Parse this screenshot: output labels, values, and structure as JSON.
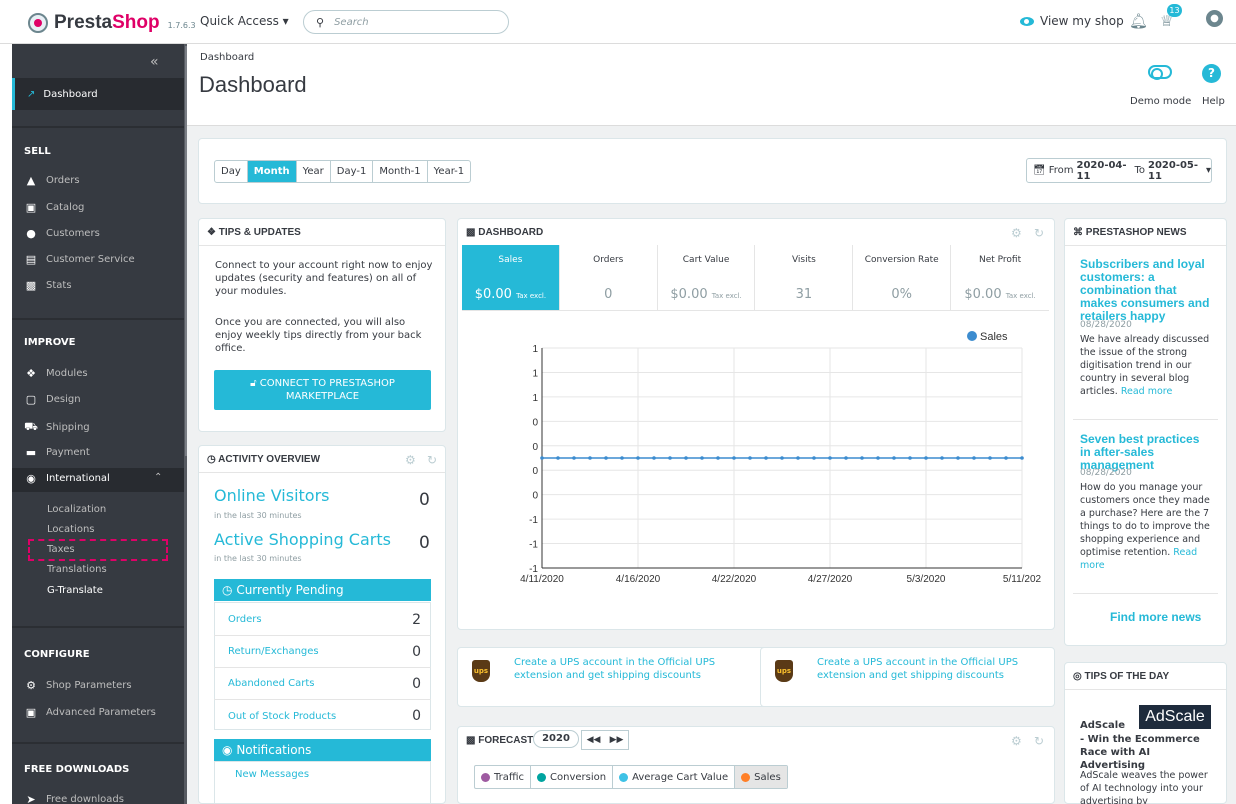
{
  "app": {
    "brand_a": "Presta",
    "brand_b": "Shop",
    "version": "1.7.6.3",
    "quick_access": "Quick Access ▾",
    "search_placeholder": "Search",
    "view_shop": "View my shop",
    "notif_count": "13"
  },
  "sidebar": {
    "dashboard": "Dashboard",
    "sell": "SELL",
    "orders": "Orders",
    "catalog": "Catalog",
    "customers": "Customers",
    "customer_service": "Customer Service",
    "stats": "Stats",
    "improve": "IMPROVE",
    "modules": "Modules",
    "design": "Design",
    "shipping": "Shipping",
    "payment": "Payment",
    "international": "International",
    "sub": [
      "Localization",
      "Locations",
      "Taxes",
      "Translations",
      "G-Translate"
    ],
    "configure": "CONFIGURE",
    "shop_params": "Shop Parameters",
    "adv_params": "Advanced Parameters",
    "free": "FREE DOWNLOADS",
    "free_dl": "Free downloads"
  },
  "header": {
    "breadcrumb": "Dashboard",
    "title": "Dashboard",
    "demo": "Demo mode",
    "help": "Help"
  },
  "period": {
    "buttons": [
      "Day",
      "Month",
      "Year",
      "Day-1",
      "Month-1",
      "Year-1"
    ],
    "active": 1,
    "from_label": "From",
    "from": "2020-04-11",
    "to_label": "To",
    "to": "2020-05-11"
  },
  "tips": {
    "title": "TIPS & UPDATES",
    "p1": "Connect to your account right now to enjoy updates (security and features) on all of your modules.",
    "p2": "Once you are connected, you will also enjoy weekly tips directly from your back office.",
    "button": "CONNECT TO PRESTASHOP MARKETPLACE"
  },
  "activity": {
    "title": "ACTIVITY OVERVIEW",
    "visitors": "Online Visitors",
    "visitors_sub": "in the last 30 minutes",
    "visitors_n": "0",
    "carts": "Active Shopping Carts",
    "carts_sub": "in the last 30 minutes",
    "carts_n": "0",
    "pending": "Currently Pending",
    "rows": [
      {
        "label": "Orders",
        "n": "2"
      },
      {
        "label": "Return/Exchanges",
        "n": "0"
      },
      {
        "label": "Abandoned Carts",
        "n": "0"
      },
      {
        "label": "Out of Stock Products",
        "n": "0"
      }
    ],
    "notifications": "Notifications",
    "new_messages": "New Messages"
  },
  "dashboard": {
    "title": "DASHBOARD",
    "kpis": [
      {
        "t": "Sales",
        "v": "$0.00",
        "s": "Tax excl."
      },
      {
        "t": "Orders",
        "v": "0",
        "s": ""
      },
      {
        "t": "Cart Value",
        "v": "$0.00",
        "s": "Tax excl."
      },
      {
        "t": "Visits",
        "v": "31",
        "s": ""
      },
      {
        "t": "Conversion Rate",
        "v": "0%",
        "s": ""
      },
      {
        "t": "Net Profit",
        "v": "$0.00",
        "s": "Tax excl."
      }
    ]
  },
  "chart_data": {
    "type": "line",
    "series": [
      {
        "name": "Sales",
        "values": [
          0,
          0,
          0,
          0,
          0,
          0,
          0,
          0,
          0,
          0,
          0,
          0,
          0,
          0,
          0,
          0,
          0,
          0,
          0,
          0,
          0,
          0,
          0,
          0,
          0,
          0,
          0,
          0,
          0,
          0,
          0
        ]
      }
    ],
    "x_ticks": [
      "4/11/2020",
      "4/16/2020",
      "4/22/2020",
      "4/27/2020",
      "5/3/2020",
      "5/11/202"
    ],
    "y_ticks": [
      "1",
      "1",
      "1",
      "0",
      "0",
      "0",
      "0",
      "-1",
      "-1",
      "-1"
    ],
    "ylim": [
      -1,
      1
    ],
    "color": "#3c8ccf",
    "legend": "top-right",
    "grid": true
  },
  "ups": [
    {
      "text": "Create a UPS account in the Official UPS extension and get shipping discounts"
    },
    {
      "text": "Create a UPS account in the Official UPS extension and get shipping discounts"
    }
  ],
  "ups_logo": "ups",
  "forecast": {
    "title": "FORECAST",
    "year": "2020",
    "legend": [
      {
        "name": "Traffic",
        "color": "#9e5ba1"
      },
      {
        "name": "Conversion",
        "color": "#00a4a0"
      },
      {
        "name": "Average Cart Value",
        "color": "#3ec2e6"
      },
      {
        "name": "Sales",
        "color": "#ff7f27"
      }
    ]
  },
  "news": {
    "title": "PRESTASHOP NEWS",
    "items": [
      {
        "title": "Subscribers and loyal customers: a combination that makes consumers and retailers happy",
        "date": "08/28/2020",
        "body": "We have already discussed the issue of the strong digitisation trend in our country in several blog articles.",
        "more": "Read more"
      },
      {
        "title": "Seven best practices in after-sales management",
        "date": "08/28/2020",
        "body": "How do you manage your customers once they made a purchase? Here are the 7 things to do to improve the shopping experience and optimise retention.",
        "more": "Read more"
      }
    ],
    "find_more": "Find more news"
  },
  "tipsday": {
    "title": "TIPS OF THE DAY",
    "logo": "AdScale",
    "name": "AdScale",
    "tagline": "- Win the Ecommerce Race with AI Advertising",
    "body": "AdScale weaves the power of AI technology into your advertising by automatically"
  }
}
